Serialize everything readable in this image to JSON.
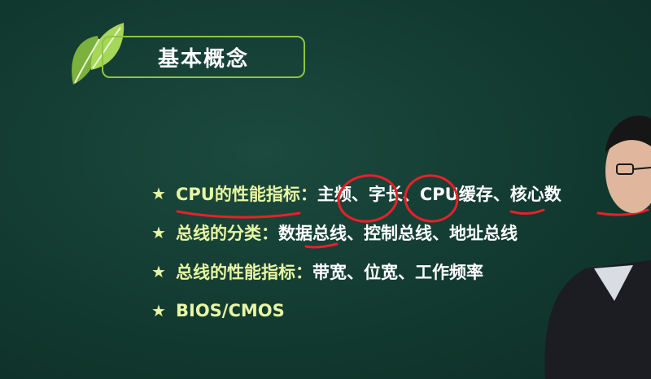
{
  "title": "基本概念",
  "bullets": [
    {
      "label": "CPU的性能指标",
      "colon": "：",
      "value": "主频、字长、CPU缓存、核心数"
    },
    {
      "label": "总线的分类",
      "colon": "：",
      "value": "数据总线、控制总线、地址总线"
    },
    {
      "label": "总线的性能指标",
      "colon": "：",
      "value": "带宽、位宽、工作频率"
    },
    {
      "label": "BIOS/CMOS",
      "colon": "",
      "value": ""
    }
  ],
  "star_symbol": "★",
  "colors": {
    "background": "#123a30",
    "accent_green": "#8dc63f",
    "label_yellow": "#e8f6a4",
    "value_white": "#ffffff",
    "annotation_red": "#e8202a"
  },
  "icons": [
    "leaf-logo-icon",
    "star-icon"
  ]
}
